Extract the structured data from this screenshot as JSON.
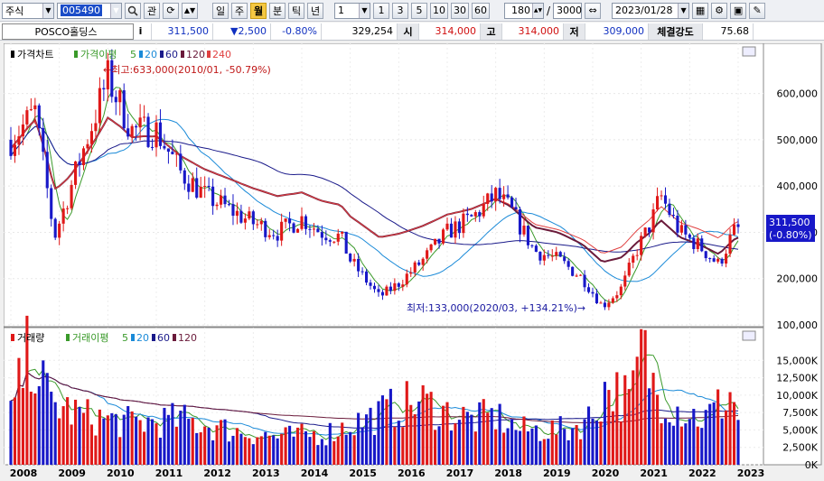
{
  "toolbar": {
    "market_select": "주식",
    "code_value": "005490",
    "btn_chart_kind": "관",
    "periods": [
      "일",
      "주",
      "월",
      "분",
      "틱",
      "년"
    ],
    "active_period": "월",
    "interval_value": "1",
    "interval_buttons": [
      "1",
      "3",
      "5",
      "10",
      "30",
      "60"
    ],
    "view_count": "180",
    "total_count": "3000",
    "date_value": "2023/01/28"
  },
  "info": {
    "name": "POSCO홀딩스",
    "info_btn": "i",
    "price": "311,500",
    "change": "▼2,500",
    "change_pct": "-0.80%",
    "volume": "329,254",
    "open_label": "시",
    "open": "314,000",
    "high_label": "고",
    "high": "314,000",
    "low_label": "저",
    "low": "309,000",
    "strength_label": "체결강도",
    "strength": "75.68"
  },
  "price_panel": {
    "legend_title": "가격차트",
    "legend_ma_title": "가격이평",
    "ma_periods": [
      "5",
      "20",
      "60",
      "120",
      "240"
    ],
    "ma_colors": [
      "#3a9a2a",
      "#1a8ad8",
      "#1a1a8a",
      "#6a1a3a",
      "#e04040"
    ],
    "max_annotation": "←최고:633,000(2010/01, -50.79%)",
    "min_annotation": "최저:133,000(2020/03, +134.21%)→",
    "y_labels": [
      "600,000",
      "500,000",
      "400,000",
      "300,000",
      "200,000",
      "100,000"
    ],
    "current_price_tag": "311,500",
    "current_pct_tag": "(-0.80%)"
  },
  "volume_panel": {
    "legend_title": "거래량",
    "legend_ma_title": "거래이평",
    "ma_periods": [
      "5",
      "20",
      "60",
      "120"
    ],
    "y_labels": [
      "15,000K",
      "12,500K",
      "10,000K",
      "7,500K",
      "5,000K",
      "2,500K",
      "0K"
    ]
  },
  "x_labels": [
    "2008",
    "2009",
    "2010",
    "2011",
    "2012",
    "2013",
    "2014",
    "2015",
    "2016",
    "2017",
    "2018",
    "2019",
    "2020",
    "2021",
    "2022",
    "2023"
  ],
  "colors": {
    "up": "#e01818",
    "down": "#1818c8",
    "panel_bg": "#ffffff"
  },
  "chart_data": {
    "type": "candlestick",
    "price_keypoints": [
      [
        2008.0,
        500000
      ],
      [
        2008.5,
        560000
      ],
      [
        2008.9,
        290000
      ],
      [
        2009.4,
        450000
      ],
      [
        2010.0,
        633000
      ],
      [
        2010.5,
        520000
      ],
      [
        2011.0,
        520000
      ],
      [
        2011.5,
        430000
      ],
      [
        2012.0,
        380000
      ],
      [
        2012.5,
        350000
      ],
      [
        2013.0,
        320000
      ],
      [
        2013.5,
        300000
      ],
      [
        2014.0,
        330000
      ],
      [
        2014.4,
        300000
      ],
      [
        2014.8,
        290000
      ],
      [
        2015.0,
        240000
      ],
      [
        2015.6,
        160000
      ],
      [
        2016.0,
        190000
      ],
      [
        2016.5,
        240000
      ],
      [
        2017.0,
        300000
      ],
      [
        2017.5,
        330000
      ],
      [
        2018.0,
        380000
      ],
      [
        2018.3,
        350000
      ],
      [
        2018.8,
        260000
      ],
      [
        2019.3,
        240000
      ],
      [
        2019.8,
        200000
      ],
      [
        2020.2,
        140000
      ],
      [
        2020.6,
        180000
      ],
      [
        2020.9,
        260000
      ],
      [
        2021.2,
        320000
      ],
      [
        2021.4,
        380000
      ],
      [
        2021.8,
        300000
      ],
      [
        2022.2,
        270000
      ],
      [
        2022.6,
        230000
      ],
      [
        2022.9,
        300000
      ],
      [
        2023.0,
        311500
      ]
    ],
    "volume_keypoints": [
      [
        2008.0,
        7000
      ],
      [
        2008.4,
        17000
      ],
      [
        2008.8,
        9000
      ],
      [
        2009.5,
        7000
      ],
      [
        2010.5,
        6000
      ],
      [
        2011.5,
        6500
      ],
      [
        2012.5,
        5000
      ],
      [
        2013.5,
        4000
      ],
      [
        2014.5,
        4500
      ],
      [
        2015.5,
        7000
      ],
      [
        2016.0,
        8500
      ],
      [
        2016.5,
        9000
      ],
      [
        2017.0,
        7500
      ],
      [
        2017.5,
        6500
      ],
      [
        2018.0,
        7000
      ],
      [
        2018.5,
        5000
      ],
      [
        2019.5,
        5000
      ],
      [
        2020.0,
        7000
      ],
      [
        2020.3,
        11500
      ],
      [
        2020.8,
        9000
      ],
      [
        2021.0,
        17000
      ],
      [
        2021.3,
        10500
      ],
      [
        2021.8,
        8000
      ],
      [
        2022.3,
        6500
      ],
      [
        2022.9,
        10500
      ],
      [
        2023.0,
        6000
      ]
    ],
    "price_ylim": [
      100000,
      650000
    ],
    "volume_ylim": [
      0,
      17500
    ]
  }
}
